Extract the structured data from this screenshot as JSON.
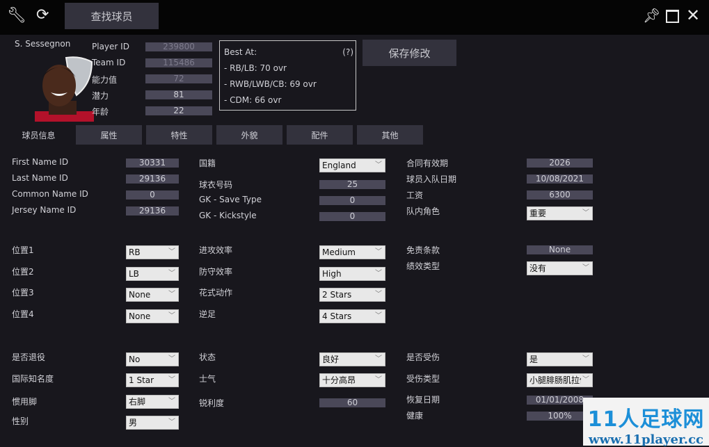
{
  "topbar": {
    "search_button": "查找球员",
    "icons": [
      "wrench-icon",
      "refresh-icon",
      "pin-icon",
      "maximize-icon",
      "close-icon"
    ]
  },
  "player": {
    "name": "S. Sessegnon",
    "header_fields": [
      {
        "label": "Player ID",
        "value": "239800",
        "dim": true
      },
      {
        "label": "Team ID",
        "value": "115486",
        "dim": true
      },
      {
        "label": "能力值",
        "value": "72",
        "dim": true
      },
      {
        "label": "潜力",
        "value": "81",
        "dim": false
      },
      {
        "label": "年龄",
        "value": "22",
        "dim": false
      }
    ]
  },
  "best_at": {
    "title": "Best At:",
    "help": "(?)",
    "lines": [
      "- RB/LB: 70 ovr",
      "- RWB/LWB/CB: 69 ovr",
      "- CDM: 66 ovr"
    ]
  },
  "save_button": "保存修改",
  "tabs": [
    "球员信息",
    "属性",
    "特性",
    "外貌",
    "配件",
    "其他"
  ],
  "active_tab": 0,
  "fields": [
    {
      "label": "First Name ID",
      "value": "30331",
      "type": "text"
    },
    {
      "label": "Last Name ID",
      "value": "29136",
      "type": "text"
    },
    {
      "label": "Common Name ID",
      "value": "0",
      "type": "text"
    },
    {
      "label": "Jersey Name ID",
      "value": "29136",
      "type": "text"
    },
    {
      "label": "国籍",
      "value": "England",
      "type": "select"
    },
    {
      "label": "球衣号码",
      "value": "25",
      "type": "text"
    },
    {
      "label": "GK - Save Type",
      "value": "0",
      "type": "text"
    },
    {
      "label": "GK - Kickstyle",
      "value": "0",
      "type": "text"
    },
    {
      "label": "合同有效期",
      "value": "2026",
      "type": "text"
    },
    {
      "label": "球员入队日期",
      "value": "10/08/2021",
      "type": "text"
    },
    {
      "label": "工资",
      "value": "6300",
      "type": "text"
    },
    {
      "label": "队内角色",
      "value": "重要",
      "type": "select"
    },
    {
      "label": "位置1",
      "value": "RB",
      "type": "select"
    },
    {
      "label": "位置2",
      "value": "LB",
      "type": "select"
    },
    {
      "label": "位置3",
      "value": "None",
      "type": "select"
    },
    {
      "label": "位置4",
      "value": "None",
      "type": "select"
    },
    {
      "label": "进攻效率",
      "value": "Medium",
      "type": "select"
    },
    {
      "label": "防守效率",
      "value": "High",
      "type": "select"
    },
    {
      "label": "花式动作",
      "value": "2 Stars",
      "type": "select"
    },
    {
      "label": "逆足",
      "value": "4 Stars",
      "type": "select"
    },
    {
      "label": "免责条款",
      "value": "None",
      "type": "text"
    },
    {
      "label": "绩效类型",
      "value": "没有",
      "type": "select"
    },
    {
      "label": "是否退役",
      "value": "No",
      "type": "select"
    },
    {
      "label": "国际知名度",
      "value": "1 Star",
      "type": "select"
    },
    {
      "label": "惯用脚",
      "value": "右脚",
      "type": "select"
    },
    {
      "label": "性别",
      "value": "男",
      "type": "select"
    },
    {
      "label": "状态",
      "value": "良好",
      "type": "select"
    },
    {
      "label": "士气",
      "value": "十分高昂",
      "type": "select"
    },
    {
      "label": "锐利度",
      "value": "60",
      "type": "text"
    },
    {
      "label": "是否受伤",
      "value": "是",
      "type": "select"
    },
    {
      "label": "受伤类型",
      "value": "小腿腓肠肌拉伤",
      "type": "select"
    },
    {
      "label": "恢复日期",
      "value": "01/01/2008",
      "type": "text"
    },
    {
      "label": "健康",
      "value": "100%",
      "type": "text"
    }
  ],
  "watermark": {
    "title": "11人足球网",
    "url": "www.11player.cc"
  }
}
